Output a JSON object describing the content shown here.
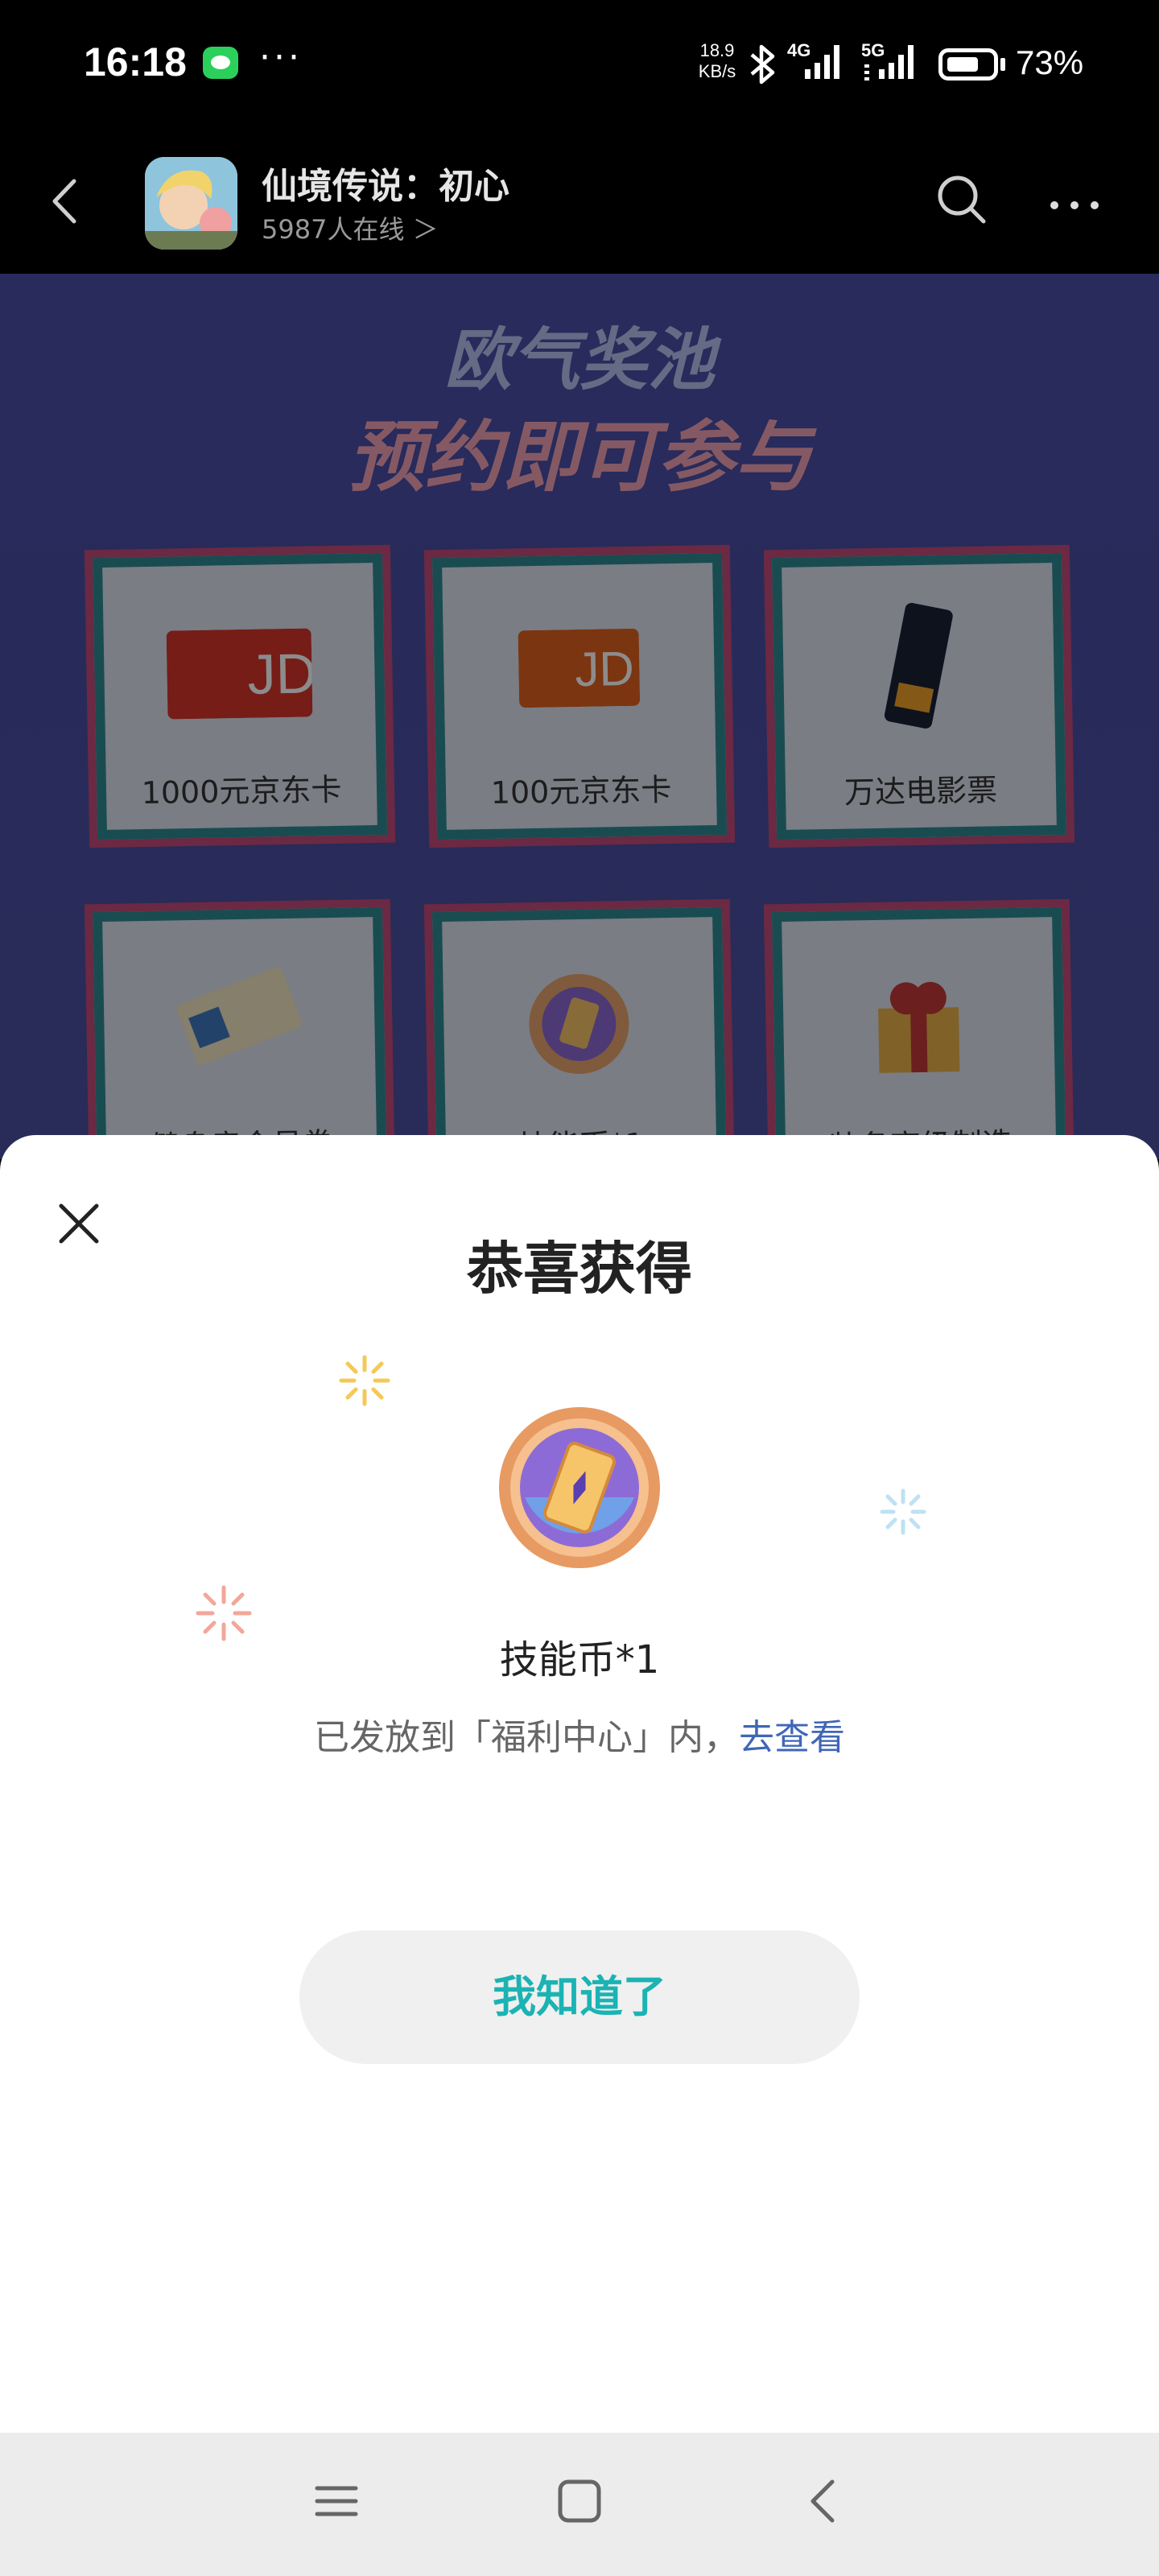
{
  "status_bar": {
    "time": "16:18",
    "more": "···",
    "net_speed_value": "18.9",
    "net_speed_unit": "KB/s",
    "signal_4g": "4G",
    "signal_5g": "5G",
    "battery_level": 0.73,
    "battery_text": "73%"
  },
  "app_bar": {
    "title": "仙境传说：初心",
    "online": "5987人在线 ＞"
  },
  "banner": {
    "title_line1": "欧气奖池",
    "title_line2": "预约即可参与",
    "prizes": [
      {
        "label": "1000元京东卡"
      },
      {
        "label": "100元京东卡"
      },
      {
        "label": "万达电影票"
      },
      {
        "label": "健身房会员卷"
      },
      {
        "label": "技能币*1"
      },
      {
        "label": "装备高级制造"
      }
    ]
  },
  "sheet": {
    "title": "恭喜获得",
    "reward_name": "技能币*1",
    "reward_desc": "已发放到「福利中心」内，",
    "reward_link": "去查看",
    "ok_button": "我知道了"
  },
  "colors": {
    "accent": "#1bb3b3",
    "link": "#3f67b6",
    "banner_bg": "#4a4fa8"
  }
}
